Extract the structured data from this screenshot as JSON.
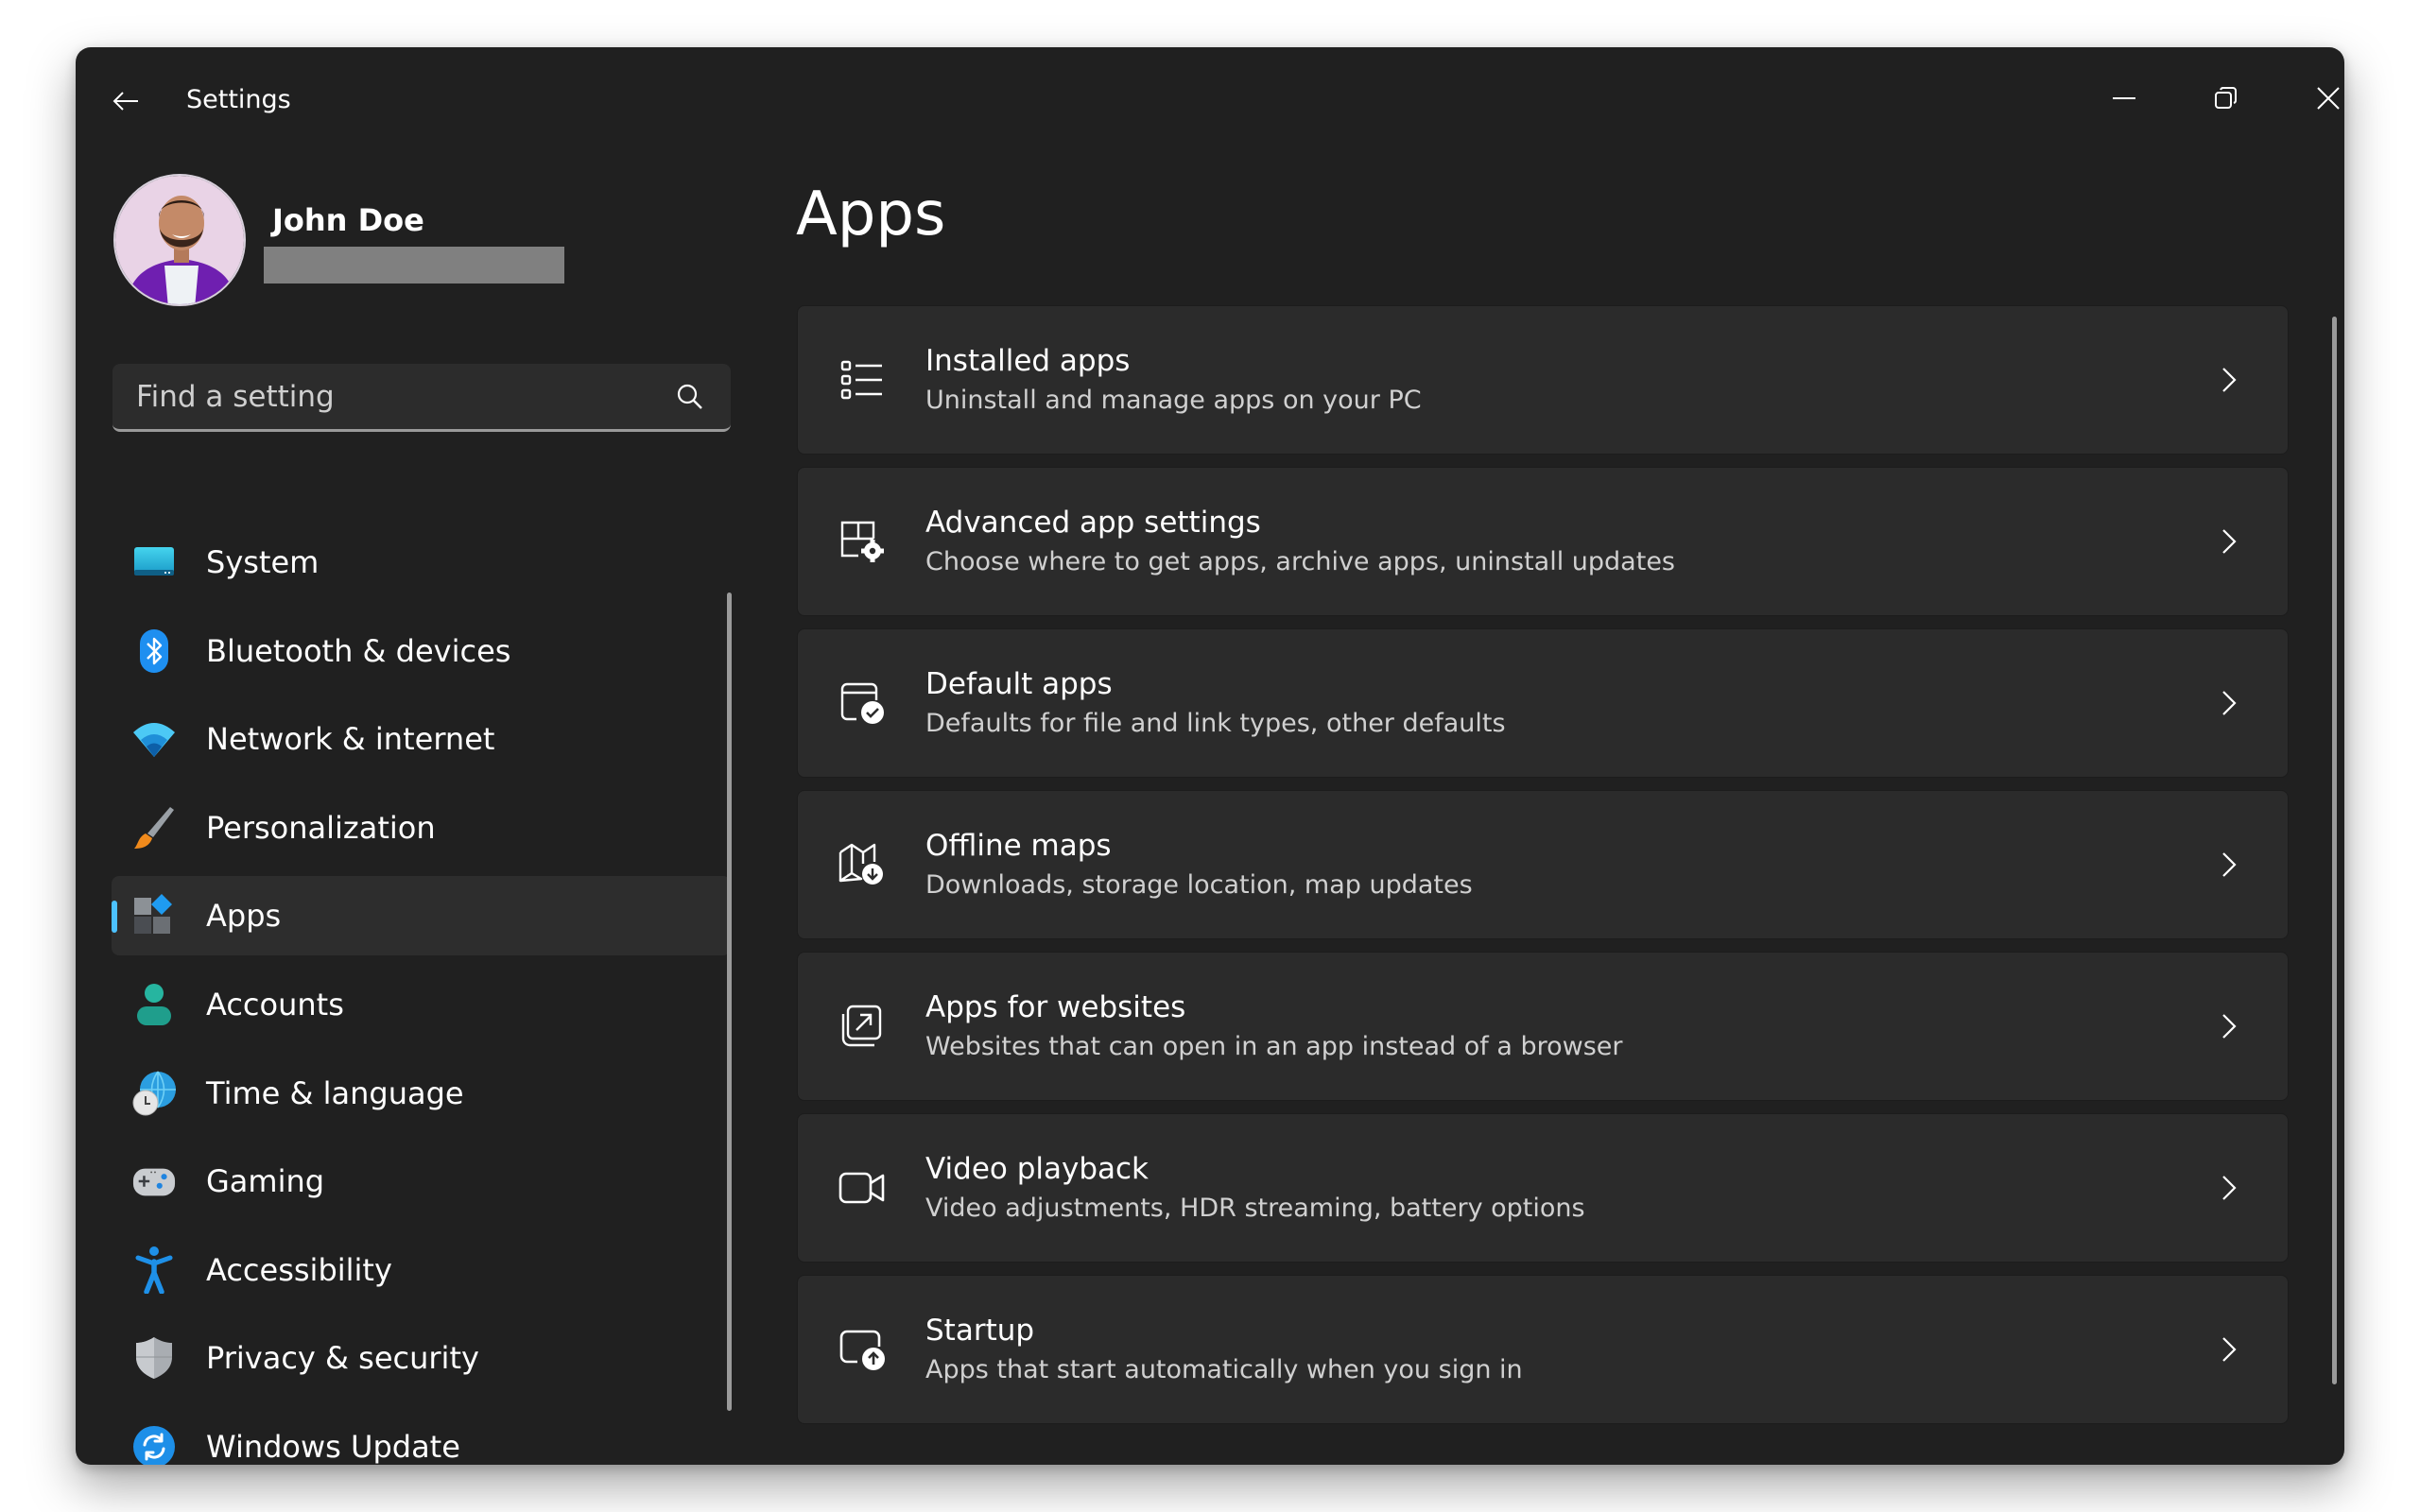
{
  "window": {
    "title": "Settings",
    "controls": {
      "minimize": "minimize-icon",
      "restore": "restore-icon",
      "close": "close-icon"
    }
  },
  "profile": {
    "name": "John Doe",
    "email_redacted": true
  },
  "search": {
    "placeholder": "Find a setting",
    "value": ""
  },
  "nav": {
    "items": [
      {
        "label": "System",
        "icon": "system-monitor-icon",
        "selected": false
      },
      {
        "label": "Bluetooth & devices",
        "icon": "bluetooth-icon",
        "selected": false
      },
      {
        "label": "Network & internet",
        "icon": "wifi-icon",
        "selected": false
      },
      {
        "label": "Personalization",
        "icon": "paintbrush-icon",
        "selected": false
      },
      {
        "label": "Apps",
        "icon": "apps-icon",
        "selected": true
      },
      {
        "label": "Accounts",
        "icon": "person-icon",
        "selected": false
      },
      {
        "label": "Time & language",
        "icon": "globe-clock-icon",
        "selected": false
      },
      {
        "label": "Gaming",
        "icon": "gamepad-icon",
        "selected": false
      },
      {
        "label": "Accessibility",
        "icon": "accessibility-icon",
        "selected": false
      },
      {
        "label": "Privacy & security",
        "icon": "shield-icon",
        "selected": false
      },
      {
        "label": "Windows Update",
        "icon": "sync-icon",
        "selected": false
      }
    ]
  },
  "main": {
    "title": "Apps",
    "cards": [
      {
        "title": "Installed apps",
        "subtitle": "Uninstall and manage apps on your PC",
        "icon": "list-icon"
      },
      {
        "title": "Advanced app settings",
        "subtitle": "Choose where to get apps, archive apps, uninstall updates",
        "icon": "app-settings-icon"
      },
      {
        "title": "Default apps",
        "subtitle": "Defaults for file and link types, other defaults",
        "icon": "default-apps-icon"
      },
      {
        "title": "Offline maps",
        "subtitle": "Downloads, storage location, map updates",
        "icon": "map-download-icon"
      },
      {
        "title": "Apps for websites",
        "subtitle": "Websites that can open in an app instead of a browser",
        "icon": "open-in-app-icon"
      },
      {
        "title": "Video playback",
        "subtitle": "Video adjustments, HDR streaming, battery options",
        "icon": "video-camera-icon"
      },
      {
        "title": "Startup",
        "subtitle": "Apps that start automatically when you sign in",
        "icon": "startup-icon"
      }
    ]
  },
  "colors": {
    "window_bg": "#202020",
    "card_bg": "#2b2b2b",
    "selected_bg": "#2d2d2d",
    "accent": "#4cc2ff",
    "redaction": "#808080"
  }
}
